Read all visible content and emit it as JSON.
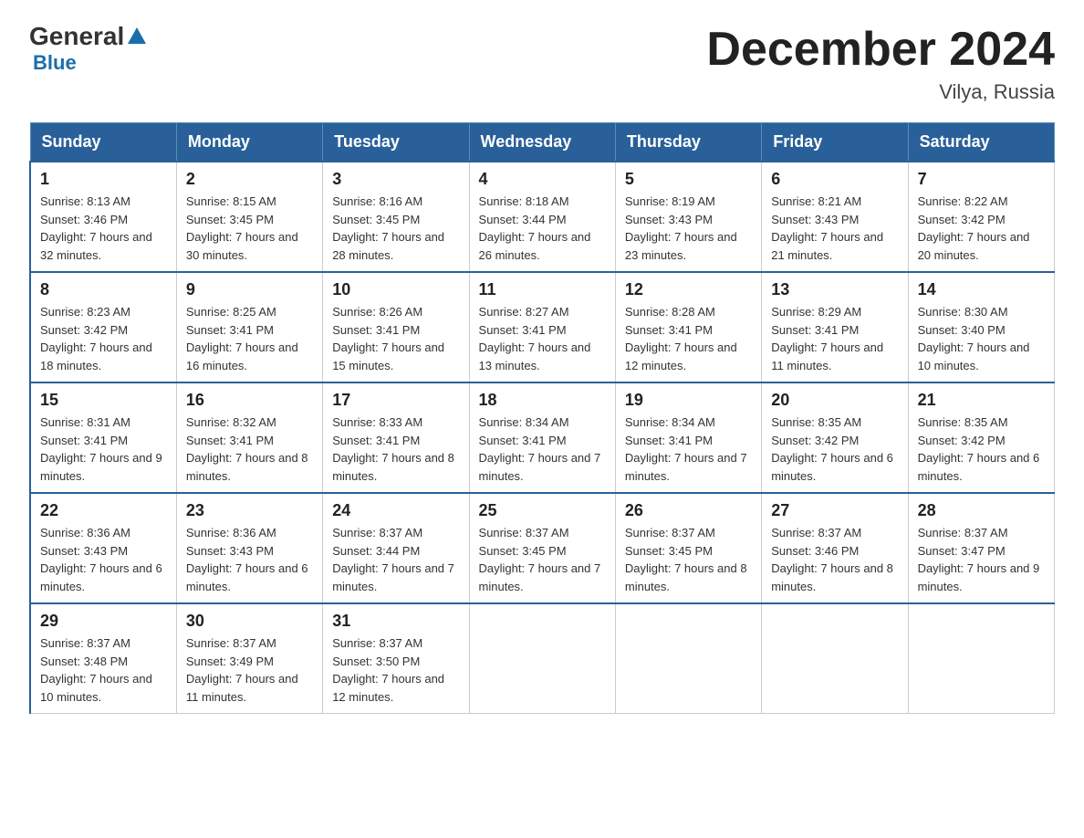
{
  "logo": {
    "general": "General",
    "triangle": "",
    "blue": "Blue"
  },
  "header": {
    "title": "December 2024",
    "subtitle": "Vilya, Russia"
  },
  "weekdays": [
    "Sunday",
    "Monday",
    "Tuesday",
    "Wednesday",
    "Thursday",
    "Friday",
    "Saturday"
  ],
  "weeks": [
    [
      {
        "day": "1",
        "sunrise": "8:13 AM",
        "sunset": "3:46 PM",
        "daylight": "7 hours and 32 minutes."
      },
      {
        "day": "2",
        "sunrise": "8:15 AM",
        "sunset": "3:45 PM",
        "daylight": "7 hours and 30 minutes."
      },
      {
        "day": "3",
        "sunrise": "8:16 AM",
        "sunset": "3:45 PM",
        "daylight": "7 hours and 28 minutes."
      },
      {
        "day": "4",
        "sunrise": "8:18 AM",
        "sunset": "3:44 PM",
        "daylight": "7 hours and 26 minutes."
      },
      {
        "day": "5",
        "sunrise": "8:19 AM",
        "sunset": "3:43 PM",
        "daylight": "7 hours and 23 minutes."
      },
      {
        "day": "6",
        "sunrise": "8:21 AM",
        "sunset": "3:43 PM",
        "daylight": "7 hours and 21 minutes."
      },
      {
        "day": "7",
        "sunrise": "8:22 AM",
        "sunset": "3:42 PM",
        "daylight": "7 hours and 20 minutes."
      }
    ],
    [
      {
        "day": "8",
        "sunrise": "8:23 AM",
        "sunset": "3:42 PM",
        "daylight": "7 hours and 18 minutes."
      },
      {
        "day": "9",
        "sunrise": "8:25 AM",
        "sunset": "3:41 PM",
        "daylight": "7 hours and 16 minutes."
      },
      {
        "day": "10",
        "sunrise": "8:26 AM",
        "sunset": "3:41 PM",
        "daylight": "7 hours and 15 minutes."
      },
      {
        "day": "11",
        "sunrise": "8:27 AM",
        "sunset": "3:41 PM",
        "daylight": "7 hours and 13 minutes."
      },
      {
        "day": "12",
        "sunrise": "8:28 AM",
        "sunset": "3:41 PM",
        "daylight": "7 hours and 12 minutes."
      },
      {
        "day": "13",
        "sunrise": "8:29 AM",
        "sunset": "3:41 PM",
        "daylight": "7 hours and 11 minutes."
      },
      {
        "day": "14",
        "sunrise": "8:30 AM",
        "sunset": "3:40 PM",
        "daylight": "7 hours and 10 minutes."
      }
    ],
    [
      {
        "day": "15",
        "sunrise": "8:31 AM",
        "sunset": "3:41 PM",
        "daylight": "7 hours and 9 minutes."
      },
      {
        "day": "16",
        "sunrise": "8:32 AM",
        "sunset": "3:41 PM",
        "daylight": "7 hours and 8 minutes."
      },
      {
        "day": "17",
        "sunrise": "8:33 AM",
        "sunset": "3:41 PM",
        "daylight": "7 hours and 8 minutes."
      },
      {
        "day": "18",
        "sunrise": "8:34 AM",
        "sunset": "3:41 PM",
        "daylight": "7 hours and 7 minutes."
      },
      {
        "day": "19",
        "sunrise": "8:34 AM",
        "sunset": "3:41 PM",
        "daylight": "7 hours and 7 minutes."
      },
      {
        "day": "20",
        "sunrise": "8:35 AM",
        "sunset": "3:42 PM",
        "daylight": "7 hours and 6 minutes."
      },
      {
        "day": "21",
        "sunrise": "8:35 AM",
        "sunset": "3:42 PM",
        "daylight": "7 hours and 6 minutes."
      }
    ],
    [
      {
        "day": "22",
        "sunrise": "8:36 AM",
        "sunset": "3:43 PM",
        "daylight": "7 hours and 6 minutes."
      },
      {
        "day": "23",
        "sunrise": "8:36 AM",
        "sunset": "3:43 PM",
        "daylight": "7 hours and 6 minutes."
      },
      {
        "day": "24",
        "sunrise": "8:37 AM",
        "sunset": "3:44 PM",
        "daylight": "7 hours and 7 minutes."
      },
      {
        "day": "25",
        "sunrise": "8:37 AM",
        "sunset": "3:45 PM",
        "daylight": "7 hours and 7 minutes."
      },
      {
        "day": "26",
        "sunrise": "8:37 AM",
        "sunset": "3:45 PM",
        "daylight": "7 hours and 8 minutes."
      },
      {
        "day": "27",
        "sunrise": "8:37 AM",
        "sunset": "3:46 PM",
        "daylight": "7 hours and 8 minutes."
      },
      {
        "day": "28",
        "sunrise": "8:37 AM",
        "sunset": "3:47 PM",
        "daylight": "7 hours and 9 minutes."
      }
    ],
    [
      {
        "day": "29",
        "sunrise": "8:37 AM",
        "sunset": "3:48 PM",
        "daylight": "7 hours and 10 minutes."
      },
      {
        "day": "30",
        "sunrise": "8:37 AM",
        "sunset": "3:49 PM",
        "daylight": "7 hours and 11 minutes."
      },
      {
        "day": "31",
        "sunrise": "8:37 AM",
        "sunset": "3:50 PM",
        "daylight": "7 hours and 12 minutes."
      },
      null,
      null,
      null,
      null
    ]
  ],
  "labels": {
    "sunrise": "Sunrise: ",
    "sunset": "Sunset: ",
    "daylight": "Daylight: "
  }
}
